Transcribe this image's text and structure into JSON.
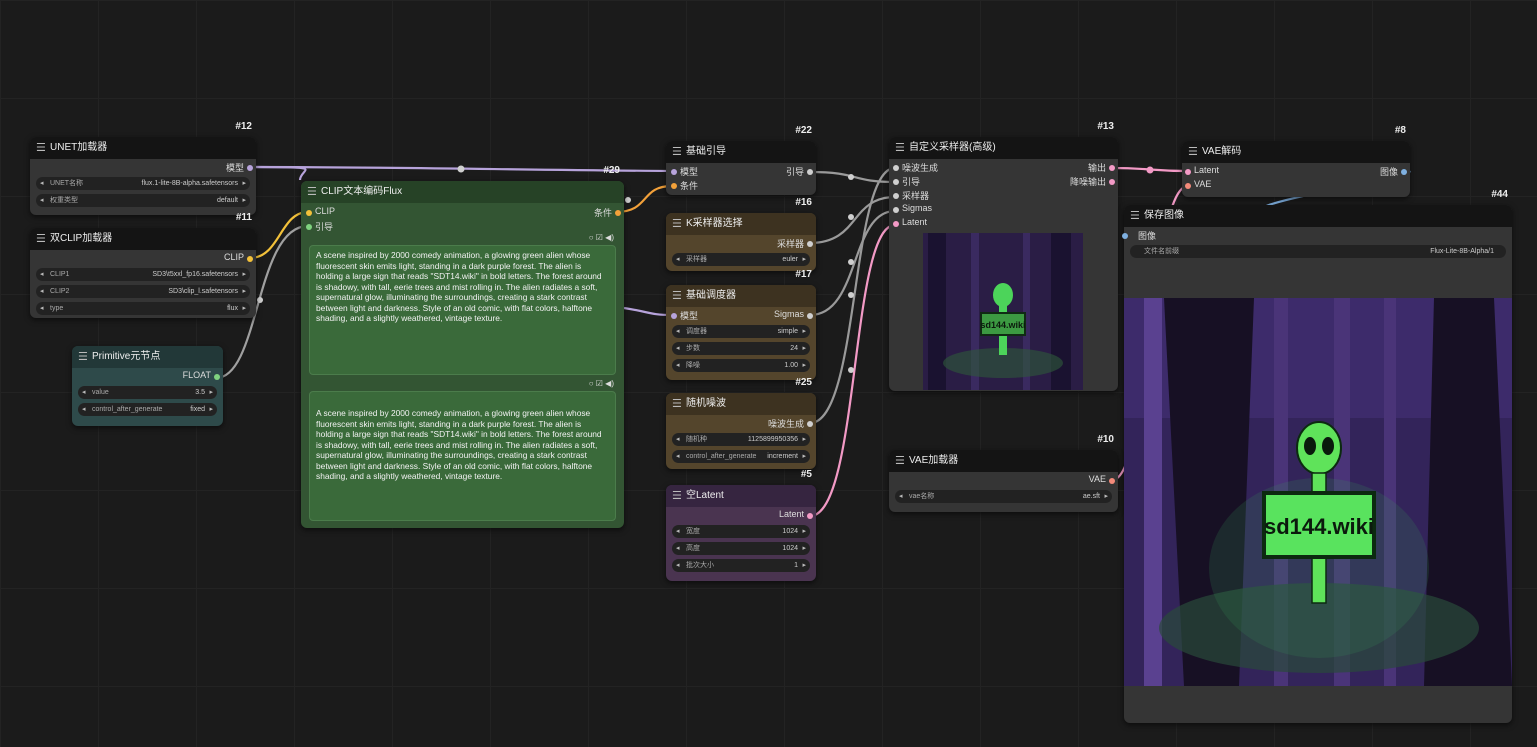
{
  "colors": {
    "canvas": "#1b1b1b",
    "model_wire": "#b7a3db",
    "clip_wire": "#f3c13a",
    "cond_wire": "#f3a13a",
    "latent_wire": "#f39ac6",
    "generic_wire": "#9a9a9a"
  },
  "unet": {
    "id": "#12",
    "title": "UNET加载器",
    "out_label": "模型",
    "w1_label": "UNET名称",
    "w1_value": "flux.1-lite-8B-alpha.safetensors",
    "w2_label": "权重类型",
    "w2_value": "default"
  },
  "dualclip": {
    "id": "#11",
    "title": "双CLIP加载器",
    "out_label": "CLIP",
    "w1_label": "CLIP1",
    "w1_value": "SD3\\t5xxl_fp16.safetensors",
    "w2_label": "CLIP2",
    "w2_value": "SD3\\clip_l.safetensors",
    "w3_label": "type",
    "w3_value": "flux"
  },
  "primitive": {
    "title": "Primitive元节点",
    "out_label": "FLOAT",
    "w1_label": "value",
    "w1_value": "3.5",
    "w2_label": "control_after_generate",
    "w2_value": "fixed"
  },
  "clipflux": {
    "id": "#29",
    "title": "CLIP文本编码Flux",
    "in1": "CLIP",
    "in2": "引导",
    "out_label": "条件",
    "prompt1": "A scene inspired by 2000 comedy animation, a glowing green alien whose fluorescent skin emits light, standing in a dark purple forest. The alien is holding a large sign that reads \"SDT14.wiki\" in bold letters. The forest around is shadowy, with tall, eerie trees and mist rolling in. The alien radiates a soft, supernatural glow, illuminating the surroundings, creating a stark contrast between light and darkness. Style of an old comic, with flat colors, halftone shading, and a slightly weathered, vintage texture.",
    "prompt2": "A scene inspired by 2000 comedy animation, a glowing green alien whose fluorescent skin emits light, standing in a dark purple forest. The alien is holding a large sign that reads \"SDT14.wiki\" in bold letters. The forest around is shadowy, with tall, eerie trees and mist rolling in. The alien radiates a soft, supernatural glow, illuminating the surroundings, creating a stark contrast between light and darkness. Style of an old comic, with flat colors, halftone shading, and a slightly weathered, vintage texture."
  },
  "guider": {
    "id": "#22",
    "title": "基础引导",
    "in1": "模型",
    "in2": "条件",
    "out_label": "引导"
  },
  "ksampler_select": {
    "id": "#16",
    "title": "K采样器选择",
    "out_label": "采样器",
    "w1_label": "采样器",
    "w1_value": "euler"
  },
  "scheduler": {
    "id": "#17",
    "title": "基础调度器",
    "in1": "模型",
    "out_label": "Sigmas",
    "w1_label": "调度器",
    "w1_value": "simple",
    "w2_label": "步数",
    "w2_value": "24",
    "w3_label": "降噪",
    "w3_value": "1.00"
  },
  "noise": {
    "id": "#25",
    "title": "随机噪波",
    "out_label": "噪波生成",
    "w1_label": "随机种",
    "w1_value": "1125899950356",
    "w2_label": "control_after_generate",
    "w2_value": "increment"
  },
  "latent": {
    "id": "#5",
    "title": "空Latent",
    "out_label": "Latent",
    "w1_label": "宽度",
    "w1_value": "1024",
    "w2_label": "高度",
    "w2_value": "1024",
    "w3_label": "批次大小",
    "w3_value": "1"
  },
  "sampler_adv": {
    "id": "#13",
    "title": "自定义采样器(高级)",
    "in1": "噪波生成",
    "in2": "引导",
    "in3": "采样器",
    "in4": "Sigmas",
    "in5": "Latent",
    "out1": "输出",
    "out2": "降噪输出",
    "preview_sign": "sd144.wiki"
  },
  "vaeloader": {
    "id": "#10",
    "title": "VAE加载器",
    "out_label": "VAE",
    "w1_label": "vae名称",
    "w1_value": "ae.sft"
  },
  "vaedecode": {
    "id": "#8",
    "title": "VAE解码",
    "in1": "Latent",
    "in2": "VAE",
    "out_label": "图像"
  },
  "saveimage": {
    "id": "#44",
    "title": "保存图像",
    "in1": "图像",
    "w1_label": "文件名前缀",
    "w1_value": "Flux-Lite-8B-Alpha/1",
    "image_sign": "sd144.wiki"
  }
}
